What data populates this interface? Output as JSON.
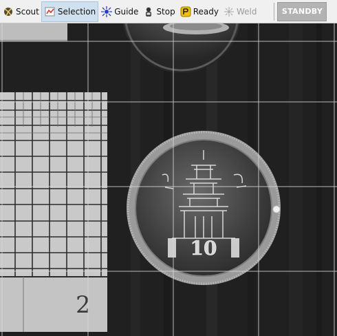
{
  "toolbar": {
    "items": [
      {
        "label": "Scout",
        "icon": "scout-icon"
      },
      {
        "label": "Selection",
        "icon": "selection-icon"
      },
      {
        "label": "Guide",
        "icon": "guide-icon"
      },
      {
        "label": "Stop",
        "icon": "stop-icon"
      },
      {
        "label": "Ready",
        "icon": "ready-icon"
      },
      {
        "label": "Weld",
        "icon": "weld-icon"
      }
    ],
    "active": "Selection",
    "disabled": "Weld",
    "status_button": "STANDBY"
  },
  "view": {
    "sample_label": "2"
  }
}
